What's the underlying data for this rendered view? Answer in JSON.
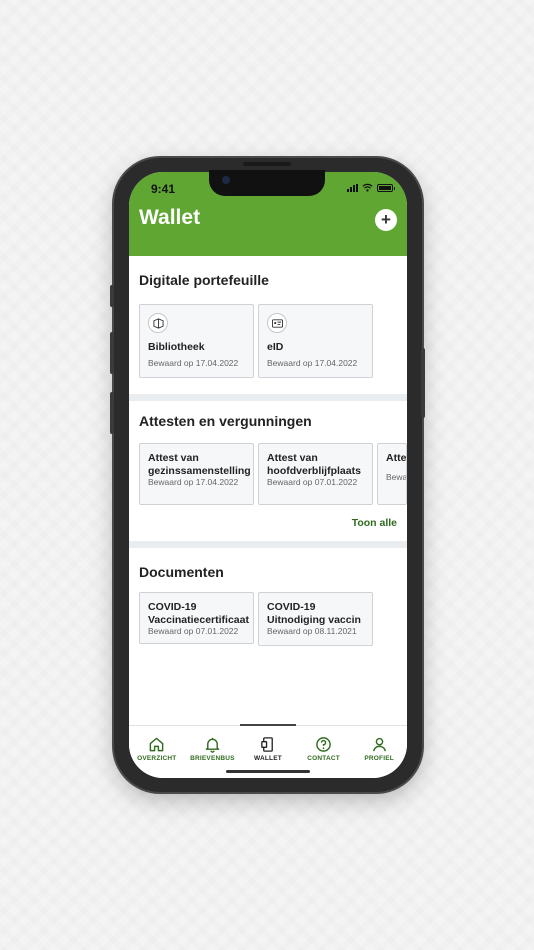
{
  "status": {
    "time": "9:41"
  },
  "header": {
    "title": "Wallet",
    "add_label": "+"
  },
  "sections": [
    {
      "title": "Digitale portefeuille",
      "cards": [
        {
          "icon": "library-icon",
          "title": "Bibliotheek",
          "subtitle": "Bewaard op 17.04.2022"
        },
        {
          "icon": "id-card-icon",
          "title": "eID",
          "subtitle": "Bewaard op 17.04.2022"
        }
      ]
    },
    {
      "title": "Attesten en vergunningen",
      "cards": [
        {
          "title": "Attest van gezinssamenstelling",
          "subtitle": "Bewaard op 17.04.2022"
        },
        {
          "title": "Attest van hoofdverblijfplaats",
          "subtitle": "Bewaard op 07.01.2022"
        },
        {
          "title": "Attes",
          "subtitle": "Bewa"
        }
      ],
      "link": "Toon alle"
    },
    {
      "title": "Documenten",
      "cards": [
        {
          "title": "COVID-19 Vaccinatiecertificaat",
          "subtitle": "Bewaard op  07.01.2022"
        },
        {
          "title": "COVID-19 Uitnodiging vaccin",
          "subtitle": "Bewaard op 08.11.2021"
        }
      ]
    }
  ],
  "tabs": [
    {
      "label": "OVERZICHT",
      "icon": "home-icon"
    },
    {
      "label": "BRIEVENBUS",
      "icon": "bell-icon"
    },
    {
      "label": "WALLET",
      "icon": "wallet-icon",
      "active": true
    },
    {
      "label": "CONTACT",
      "icon": "help-icon"
    },
    {
      "label": "PROFIEL",
      "icon": "person-icon"
    }
  ],
  "colors": {
    "accent": "#5fa633",
    "link": "#2f6b1e"
  }
}
